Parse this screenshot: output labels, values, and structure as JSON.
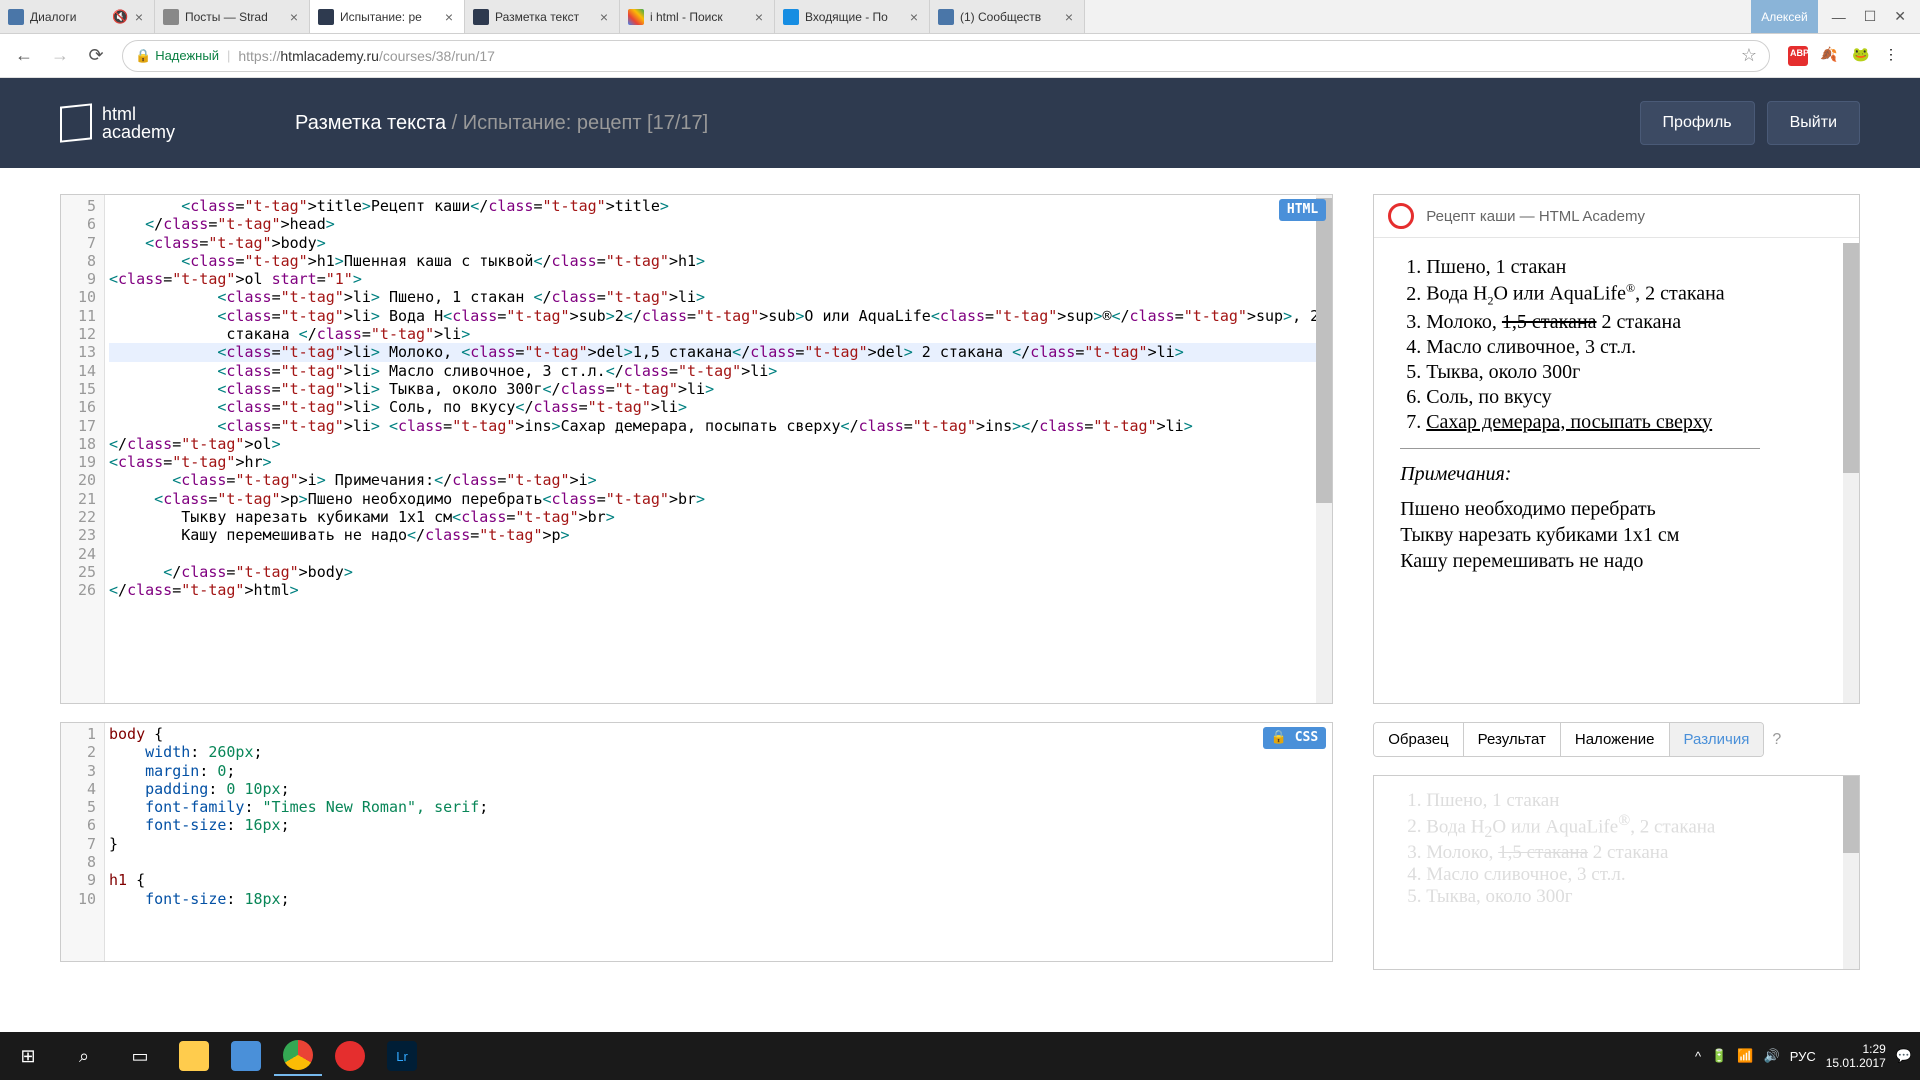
{
  "browser": {
    "tabs": [
      {
        "title": "Диалоги",
        "muted": true
      },
      {
        "title": "Посты — Strad"
      },
      {
        "title": "Испытание: ре",
        "active": true
      },
      {
        "title": "Разметка текст"
      },
      {
        "title": "i html - Поиск"
      },
      {
        "title": "Входящие - По"
      },
      {
        "title": "(1) Сообществ"
      }
    ],
    "user": "Алексей",
    "secure": "Надежный",
    "url_full": "https://htmlacademy.ru/courses/38/run/17"
  },
  "header": {
    "logo": "html academy",
    "crumb_main": "Разметка текста",
    "crumb_sep": " / ",
    "crumb_sub": "Испытание: рецепт  [17/17]",
    "profile": "Профиль",
    "logout": "Выйти"
  },
  "editor_html": {
    "badge": "HTML",
    "start": 5,
    "lines": [
      "        <title>Рецепт каши</title>",
      "    </head>",
      "    <body>",
      "        <h1>Пшенная каша с тыквой</h1>",
      "<ol start=\"1\">",
      "            <li> Пшено, 1 стакан </li>",
      "            <li> Вода H<sub>2</sub>O или AquaLife<sup>®</sup>, 2 ",
      "             стакана </li>",
      "            <li> Молоко, <del>1,5 стакана</del> 2 стакана </li>",
      "            <li> Масло сливочное, 3 ст.л.</li>",
      "            <li> Тыква, около 300г</li>",
      "            <li> Соль, по вкусу</li>",
      "            <li> <ins>Сахар демерара, посыпать сверху</ins></li>",
      "</ol>",
      "<hr>",
      "       <i> Примечания:</i>",
      "     <p>Пшено необходимо перебрать<br>",
      "        Тыкву нарезать кубиками 1x1 см<br>",
      "        Кашу перемешивать не надо</p>",
      "",
      "      </body>",
      "</html>"
    ],
    "active_line": 13
  },
  "editor_css": {
    "badge": "CSS",
    "start": 1,
    "lines": [
      "body {",
      "    width: 260px;",
      "    margin: 0;",
      "    padding: 0 10px;",
      "    font-family: \"Times New Roman\", serif;",
      "    font-size: 16px;",
      "}",
      "",
      "h1 {",
      "    font-size: 18px;"
    ]
  },
  "preview": {
    "tab_title": "Рецепт каши — HTML Academy",
    "items": [
      "Пшено, 1 стакан",
      "Вода H2O или AquaLife®, 2 стакана",
      "Молоко, 1,5 стакана 2 стакана",
      "Масло сливочное, 3 ст.л.",
      "Тыква, около 300г",
      "Соль, по вкусу",
      "Сахар демерара, посыпать сверху"
    ],
    "notes_h": "Примечания:",
    "notes": [
      "Пшено необходимо перебрать",
      "Тыкву нарезать кубиками 1x1 см",
      "Кашу перемешивать не надо"
    ]
  },
  "compare": {
    "tabs": [
      "Образец",
      "Результат",
      "Наложение",
      "Различия"
    ],
    "active": 3,
    "help": "?"
  },
  "taskbar": {
    "lang": "РУС",
    "time": "1:29",
    "date": "15.01.2017"
  }
}
